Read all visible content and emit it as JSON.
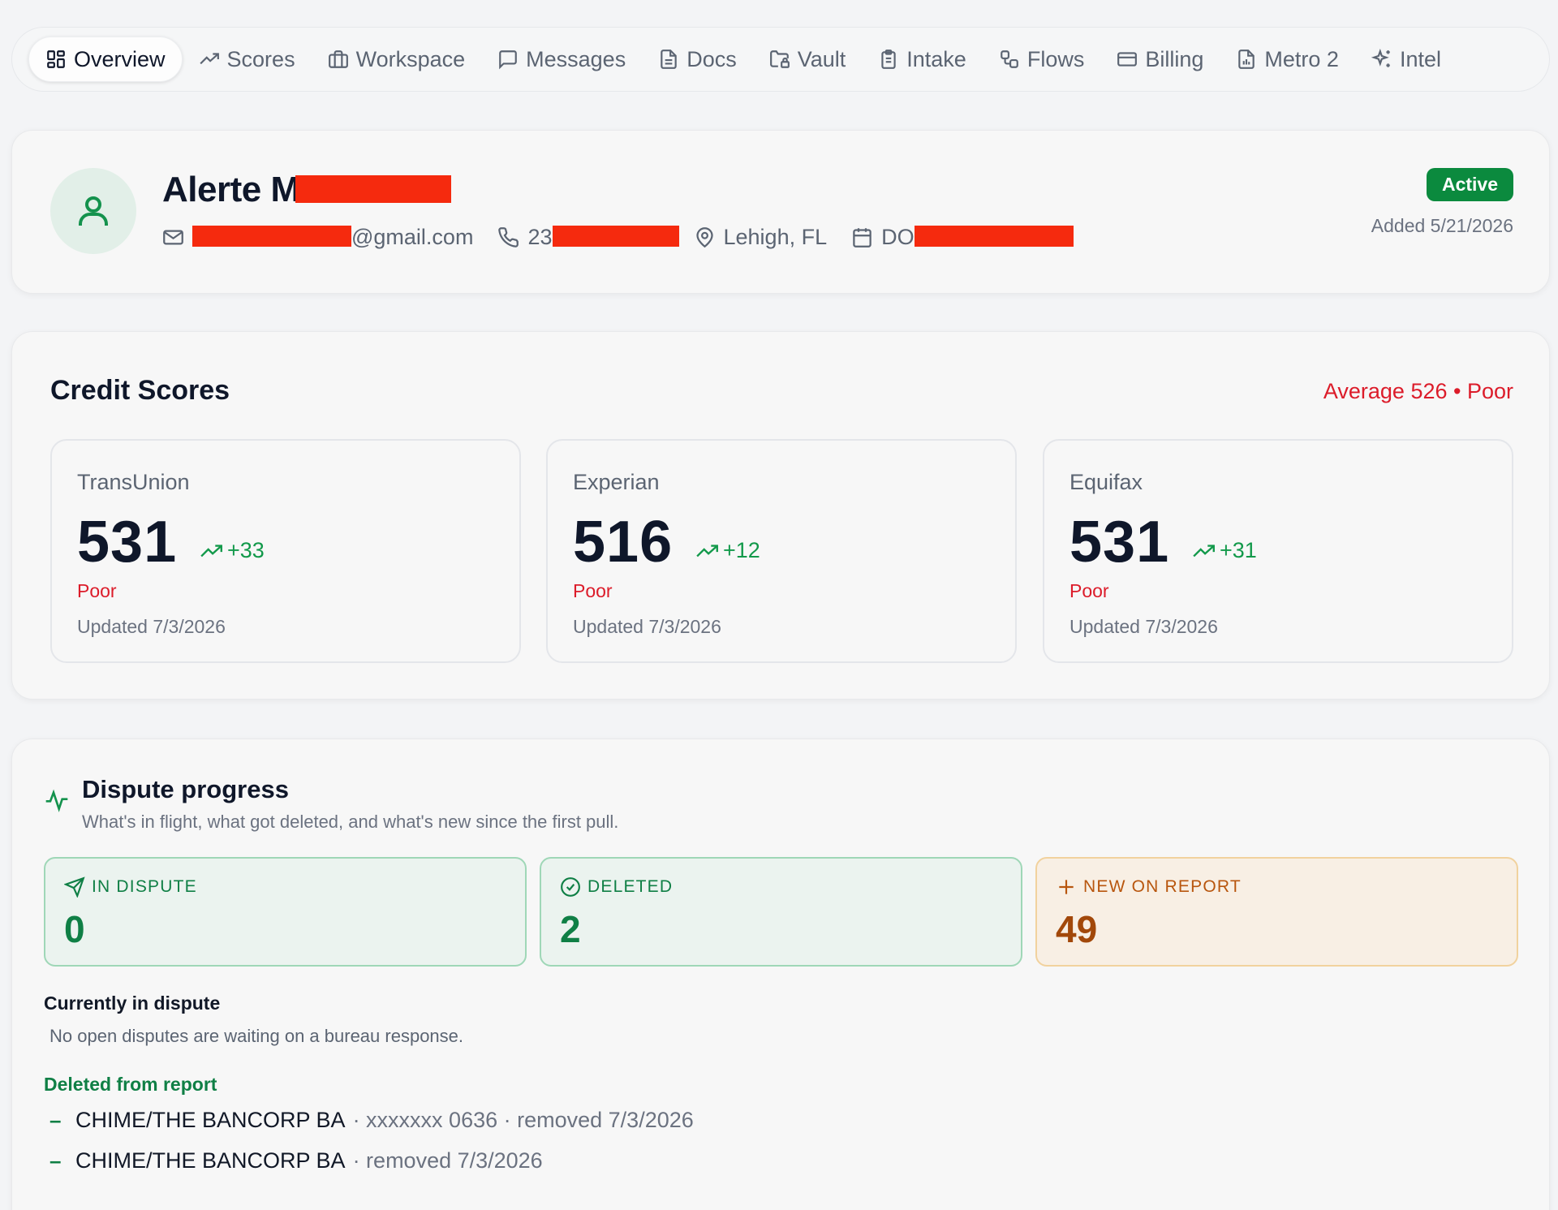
{
  "nav": {
    "tabs": [
      {
        "label": "Overview",
        "icon": "grid-icon",
        "active": true
      },
      {
        "label": "Scores",
        "icon": "trending-up-icon",
        "active": false
      },
      {
        "label": "Workspace",
        "icon": "briefcase-icon",
        "active": false
      },
      {
        "label": "Messages",
        "icon": "message-icon",
        "active": false
      },
      {
        "label": "Docs",
        "icon": "document-icon",
        "active": false
      },
      {
        "label": "Vault",
        "icon": "folder-lock-icon",
        "active": false
      },
      {
        "label": "Intake",
        "icon": "clipboard-icon",
        "active": false
      },
      {
        "label": "Flows",
        "icon": "workflow-icon",
        "active": false
      },
      {
        "label": "Billing",
        "icon": "credit-card-icon",
        "active": false
      },
      {
        "label": "Metro 2",
        "icon": "file-chart-icon",
        "active": false
      },
      {
        "label": "Intel",
        "icon": "sparkles-icon",
        "active": false
      }
    ]
  },
  "profile": {
    "name": "Alerte M",
    "email_suffix": "@gmail.com",
    "phone_prefix": "23",
    "location": "Lehigh, FL",
    "dob_prefix": "DO",
    "status": "Active",
    "added": "Added 5/21/2026"
  },
  "scores": {
    "title": "Credit Scores",
    "average": "Average 526 • Poor",
    "bureaus": [
      {
        "name": "TransUnion",
        "score": "531",
        "change": "+33",
        "rating": "Poor",
        "updated": "Updated 7/3/2026"
      },
      {
        "name": "Experian",
        "score": "516",
        "change": "+12",
        "rating": "Poor",
        "updated": "Updated 7/3/2026"
      },
      {
        "name": "Equifax",
        "score": "531",
        "change": "+31",
        "rating": "Poor",
        "updated": "Updated 7/3/2026"
      }
    ]
  },
  "dispute": {
    "title": "Dispute progress",
    "subtitle": "What's in flight, what got deleted, and what's new since the first pull.",
    "stats": [
      {
        "label": "IN DISPUTE",
        "value": "0",
        "icon": "send-icon"
      },
      {
        "label": "DELETED",
        "value": "2",
        "icon": "check-circle-icon"
      },
      {
        "label": "NEW ON REPORT",
        "value": "49",
        "icon": "plus-icon"
      }
    ],
    "current_heading": "Currently in dispute",
    "current_empty": "No open disputes are waiting on a bureau response.",
    "deleted_heading": "Deleted from report",
    "deleted_items": [
      {
        "creditor": "CHIME/THE BANCORP BA",
        "meta": "· xxxxxxx 0636 · removed 7/3/2026"
      },
      {
        "creditor": "CHIME/THE BANCORP BA",
        "meta": "· removed 7/3/2026"
      }
    ],
    "colors": {
      "green": "#0f7f45",
      "orange": "#b8560e",
      "red": "#dc1c2a"
    }
  }
}
